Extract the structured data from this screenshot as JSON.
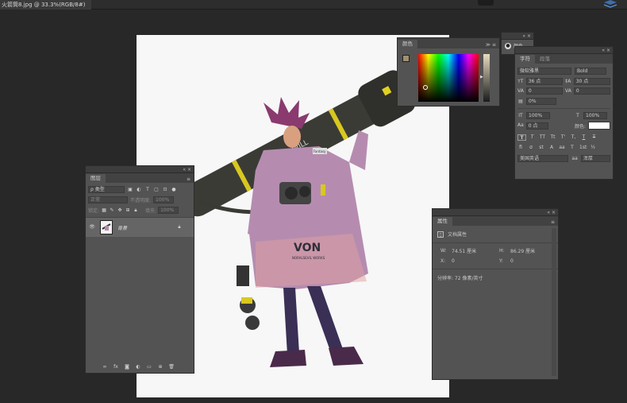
{
  "document": {
    "tab_title": "火箭筒8.jpg @ 33.3%(RGB/8#)"
  },
  "colors": {
    "foreground": "#a09070",
    "background": "#e8e0c8"
  },
  "color_panel": {
    "title": "颜色",
    "mini_label": "颜色"
  },
  "char_panel": {
    "tabs": [
      "字符",
      "段落"
    ],
    "font_family": "微软雅黑",
    "font_style": "Bold",
    "size": "36 点",
    "leading": "30 点",
    "kerning": "0",
    "tracking": "0",
    "tsume": "0%",
    "vscale": "100%",
    "hscale": "100%",
    "baseline": "0 点",
    "color_label": "颜色:",
    "language": "美国英语",
    "antialias": "浑厚",
    "style_buttons": [
      "T",
      "T",
      "TT",
      "Tt",
      "T'",
      "T,",
      "T",
      "T"
    ]
  },
  "layers_panel": {
    "title": "图层",
    "kind_filter": "ρ 类型",
    "blend_mode": "正常",
    "opacity_label": "不透明度:",
    "opacity": "100%",
    "lock_label": "锁定:",
    "fill_label": "填充:",
    "fill": "100%",
    "layer_name": "背景"
  },
  "properties_panel": {
    "title": "属性",
    "section": "文档属性",
    "w_label": "W:",
    "w_value": "74.51 厘米",
    "h_label": "H:",
    "h_value": "86.29 厘米",
    "x_label": "X:",
    "x_value": "0",
    "y_label": "Y:",
    "y_value": "0",
    "resolution": "分辨率: 72 像素/英寸"
  },
  "artwork": {
    "jacket_text": "VON",
    "jacket_sub": "NORALSEVIL WORKS",
    "rocket_text": "RE WILL",
    "tag_text": "Fantasy"
  }
}
